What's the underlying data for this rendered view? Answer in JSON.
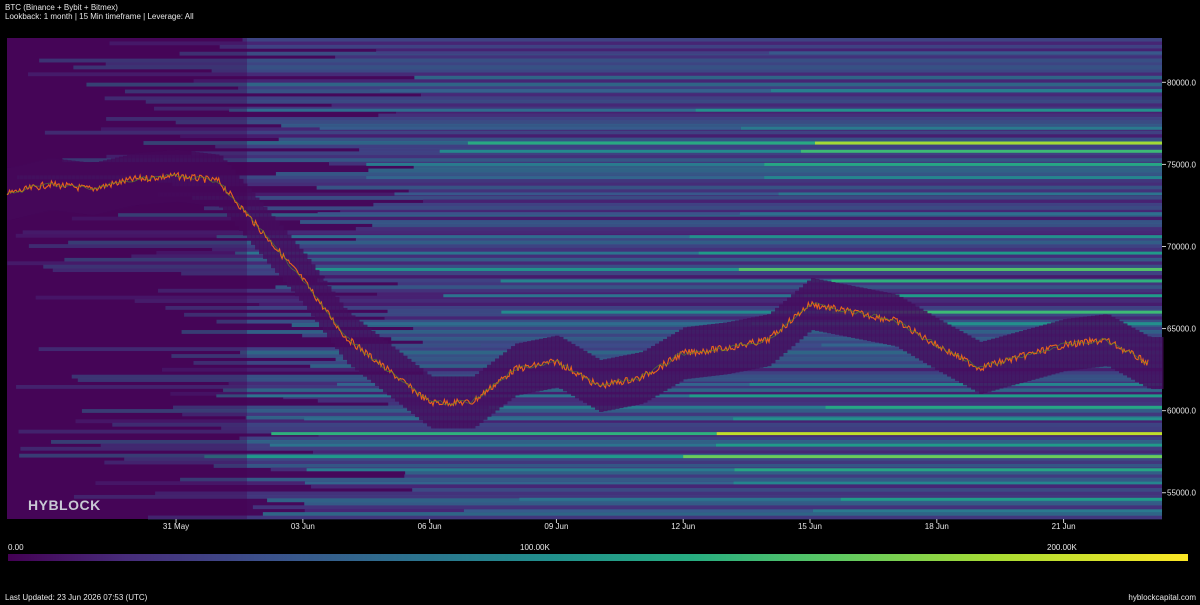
{
  "header": {
    "title": "BTC (Binance + Bybit + Bitmex)",
    "subtitle": "Lookback: 1 month | 15 Min timeframe | Leverage: All"
  },
  "watermark": "HYBLOCK",
  "colorbar": {
    "labels": [
      "0.00",
      "100.00K",
      "200.00K"
    ],
    "min": 0,
    "max": 220000
  },
  "footer": {
    "updated": "Last Updated: 23 Jun 2026 07:53 (UTC)",
    "site": "hyblockcapital.com"
  },
  "chart_data": {
    "type": "heatmap",
    "title": "BTC (Binance + Bybit + Bitmex)",
    "subtitle": "Lookback: 1 month | 15 Min timeframe | Leverage: All",
    "x_ticks": [
      "31 May",
      "03 Jun",
      "06 Jun",
      "09 Jun",
      "12 Jun",
      "15 Jun",
      "18 Jun",
      "21 Jun"
    ],
    "y_ticks": [
      "55000.0",
      "60000.0",
      "65000.0",
      "70000.0",
      "75000.0",
      "80000.0"
    ],
    "ylim": [
      53400,
      82700
    ],
    "xlim_days": [
      "27 May",
      "23 Jun 07:53"
    ],
    "colorscale": "viridis",
    "color_range": [
      0,
      220000
    ],
    "price_series": {
      "name": "BTC",
      "x": [
        "27 May",
        "28 May",
        "29 May",
        "30 May",
        "31 May",
        "01 Jun",
        "02 Jun",
        "03 Jun",
        "04 Jun",
        "05 Jun",
        "06 Jun",
        "07 Jun",
        "08 Jun",
        "09 Jun",
        "10 Jun",
        "11 Jun",
        "12 Jun",
        "13 Jun",
        "14 Jun",
        "15 Jun",
        "16 Jun",
        "17 Jun",
        "18 Jun",
        "19 Jun",
        "20 Jun",
        "21 Jun",
        "22 Jun",
        "23 Jun"
      ],
      "y": [
        73200,
        73800,
        73500,
        74100,
        74300,
        74000,
        71000,
        68000,
        64500,
        62500,
        60500,
        60500,
        62500,
        63000,
        61500,
        62000,
        63500,
        63800,
        64300,
        66500,
        66000,
        65500,
        64000,
        62600,
        63300,
        64000,
        64300,
        62900
      ]
    },
    "liquidity_bands": [
      {
        "price": 81800,
        "level": 60000
      },
      {
        "price": 79500,
        "level": 95000
      },
      {
        "price": 78300,
        "level": 110000
      },
      {
        "price": 77200,
        "level": 90000
      },
      {
        "price": 76300,
        "level": 190000
      },
      {
        "price": 75800,
        "level": 150000
      },
      {
        "price": 75000,
        "level": 130000
      },
      {
        "price": 74200,
        "level": 100000
      },
      {
        "price": 73200,
        "level": 85000
      },
      {
        "price": 72000,
        "level": 80000
      },
      {
        "price": 70600,
        "level": 110000
      },
      {
        "price": 69600,
        "level": 120000
      },
      {
        "price": 68600,
        "level": 160000
      },
      {
        "price": 67900,
        "level": 140000
      },
      {
        "price": 67000,
        "level": 120000
      },
      {
        "price": 66000,
        "level": 150000
      },
      {
        "price": 65300,
        "level": 110000
      },
      {
        "price": 64000,
        "level": 70000
      },
      {
        "price": 61600,
        "level": 100000
      },
      {
        "price": 60900,
        "level": 120000
      },
      {
        "price": 60200,
        "level": 130000
      },
      {
        "price": 59500,
        "level": 110000
      },
      {
        "price": 58600,
        "level": 200000
      },
      {
        "price": 57900,
        "level": 120000
      },
      {
        "price": 57200,
        "level": 170000
      },
      {
        "price": 56400,
        "level": 130000
      },
      {
        "price": 55600,
        "level": 100000
      },
      {
        "price": 54600,
        "level": 120000
      },
      {
        "price": 53900,
        "level": 90000
      }
    ]
  }
}
